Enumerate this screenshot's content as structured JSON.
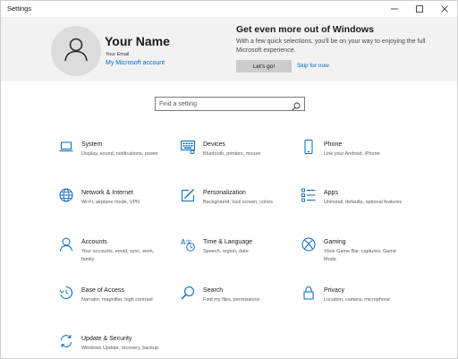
{
  "window": {
    "title": "Settings"
  },
  "profile": {
    "name": "Your Name",
    "email": "Your Email",
    "account_link": "My Microsoft account"
  },
  "promo": {
    "title": "Get even more out of Windows",
    "text": "With a few quick selections, you'll be on your way to enjoying the full Microsoft experience.",
    "primary_button": "Let's go!",
    "skip_link": "Skip for now"
  },
  "search": {
    "placeholder": "Find a setting",
    "value": ""
  },
  "accent_color": "#0067c0",
  "settings": [
    {
      "name": "System",
      "desc": "Display, sound, notifications, power",
      "icon": "laptop-icon"
    },
    {
      "name": "Devices",
      "desc": "Bluetooth, printers, mouse",
      "icon": "keyboard-icon"
    },
    {
      "name": "Phone",
      "desc": "Link your Android, iPhone",
      "icon": "phone-icon"
    },
    {
      "name": "Network & Internet",
      "desc": "Wi-Fi, airplane mode, VPN",
      "icon": "globe-icon"
    },
    {
      "name": "Personalization",
      "desc": "Background, lock screen, colors",
      "icon": "paintbrush-icon"
    },
    {
      "name": "Apps",
      "desc": "Uninstall, defaults, optional features",
      "icon": "apps-list-icon"
    },
    {
      "name": "Accounts",
      "desc": "Your accounts, email, sync, work, family",
      "icon": "person-icon"
    },
    {
      "name": "Time & Language",
      "desc": "Speech, region, date",
      "icon": "time-language-icon"
    },
    {
      "name": "Gaming",
      "desc": "Xbox Game Bar, captures, Game Mode",
      "icon": "xbox-icon"
    },
    {
      "name": "Ease of Access",
      "desc": "Narrator, magnifier, high contrast",
      "icon": "ease-of-access-icon"
    },
    {
      "name": "Search",
      "desc": "Find my files, permissions",
      "icon": "search-icon"
    },
    {
      "name": "Privacy",
      "desc": "Location, camera, microphone",
      "icon": "lock-icon"
    },
    {
      "name": "Update & Security",
      "desc": "Windows Update, recovery, backup",
      "icon": "sync-arrows-icon"
    }
  ]
}
